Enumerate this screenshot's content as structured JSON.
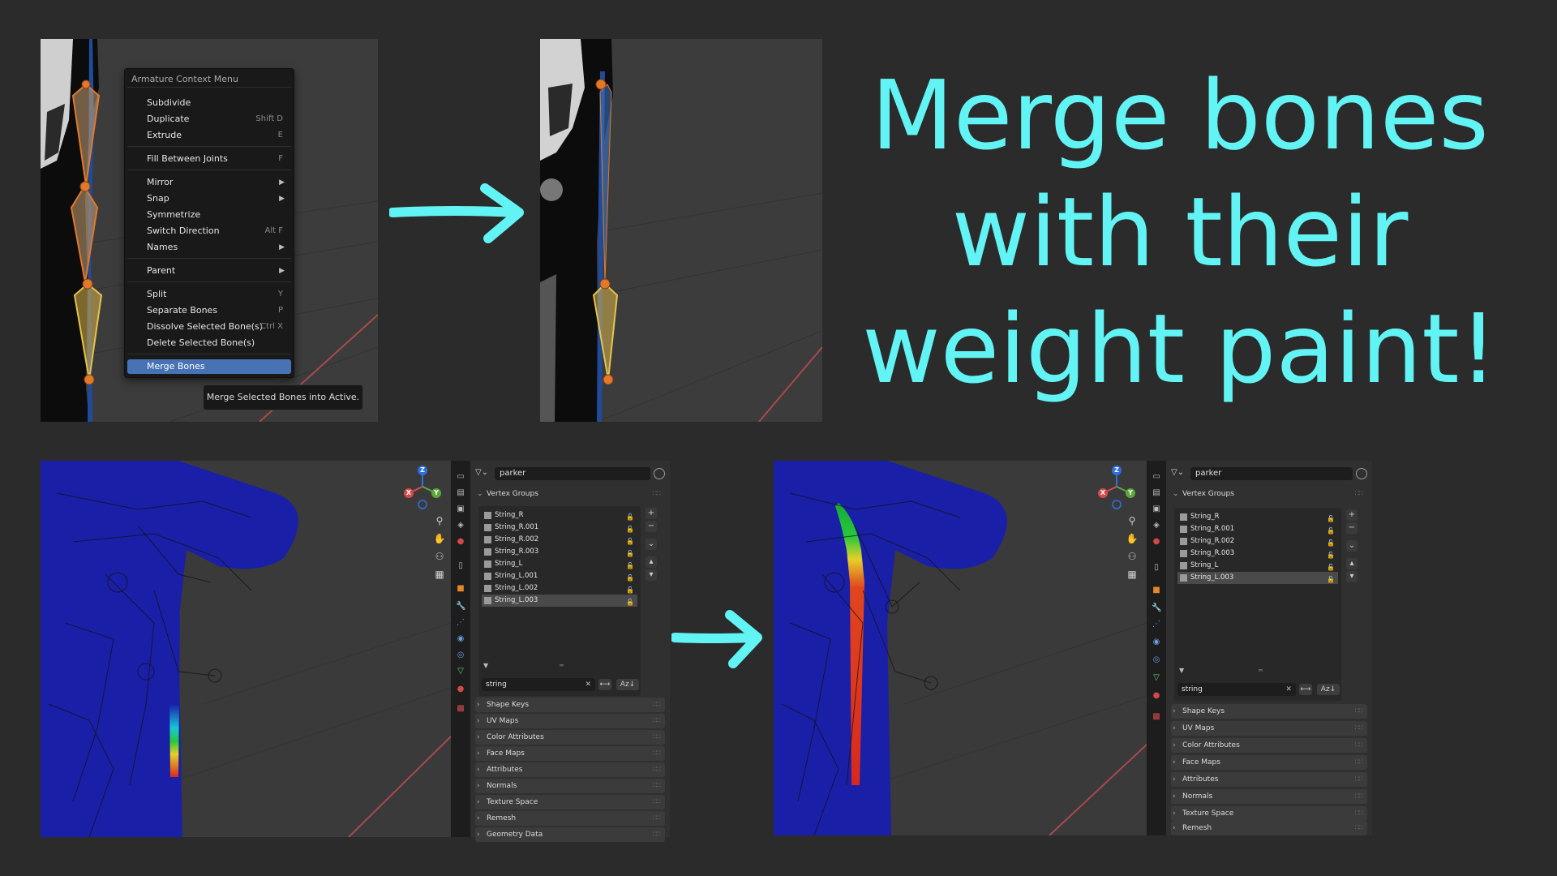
{
  "headline": {
    "line1": "Merge bones",
    "line2": "with their",
    "line3": "weight paint!"
  },
  "context_menu": {
    "title": "Armature Context Menu",
    "items": [
      {
        "label": "Subdivide",
        "shortcut": ""
      },
      {
        "label": "Duplicate",
        "shortcut": "Shift D"
      },
      {
        "label": "Extrude",
        "shortcut": "E"
      },
      {
        "label": "Fill Between Joints",
        "shortcut": "F"
      },
      {
        "label": "Mirror",
        "shortcut": ""
      },
      {
        "label": "Snap",
        "shortcut": ""
      },
      {
        "label": "Symmetrize",
        "shortcut": ""
      },
      {
        "label": "Switch Direction",
        "shortcut": "Alt F"
      },
      {
        "label": "Names",
        "shortcut": ""
      },
      {
        "label": "Parent",
        "shortcut": ""
      },
      {
        "label": "Split",
        "shortcut": "Y"
      },
      {
        "label": "Separate Bones",
        "shortcut": "P"
      },
      {
        "label": "Dissolve Selected Bone(s)",
        "shortcut": "Ctrl X"
      },
      {
        "label": "Delete Selected Bone(s)",
        "shortcut": ""
      },
      {
        "label": "Merge Bones",
        "shortcut": ""
      }
    ],
    "tooltip": "Merge Selected Bones into Active."
  },
  "properties_before": {
    "object_name": "parker",
    "vertex_groups_title": "Vertex Groups",
    "vertex_groups": [
      "String_R",
      "String_R.001",
      "String_R.002",
      "String_R.003",
      "String_L",
      "String_L.001",
      "String_L.002",
      "String_L.003"
    ],
    "selected_group": "String_L.003",
    "filter_text": "string",
    "sections": [
      "Shape Keys",
      "UV Maps",
      "Color Attributes",
      "Face Maps",
      "Attributes",
      "Normals",
      "Texture Space",
      "Remesh",
      "Geometry Data"
    ]
  },
  "properties_after": {
    "object_name": "parker",
    "vertex_groups_title": "Vertex Groups",
    "vertex_groups": [
      "String_R",
      "String_R.001",
      "String_R.002",
      "String_R.003",
      "String_L",
      "String_L.003"
    ],
    "selected_group": "String_L.003",
    "filter_text": "string",
    "sections": [
      "Shape Keys",
      "UV Maps",
      "Color Attributes",
      "Face Maps",
      "Attributes",
      "Normals",
      "Texture Space",
      "Remesh"
    ]
  },
  "gizmo_axes": {
    "x": "X",
    "y": "Y",
    "z": "Z"
  },
  "sort_button": "Az",
  "colors": {
    "headline": "#62f4f4",
    "arrow": "#62f4f4",
    "menu_highlight": "#4772b3",
    "weight_base": "#1a1fa8"
  },
  "icons": [
    "search-icon",
    "hand-icon",
    "camera-icon",
    "grid-icon",
    "mesh-data-icon",
    "pin-icon",
    "lock-icon",
    "x-icon"
  ]
}
